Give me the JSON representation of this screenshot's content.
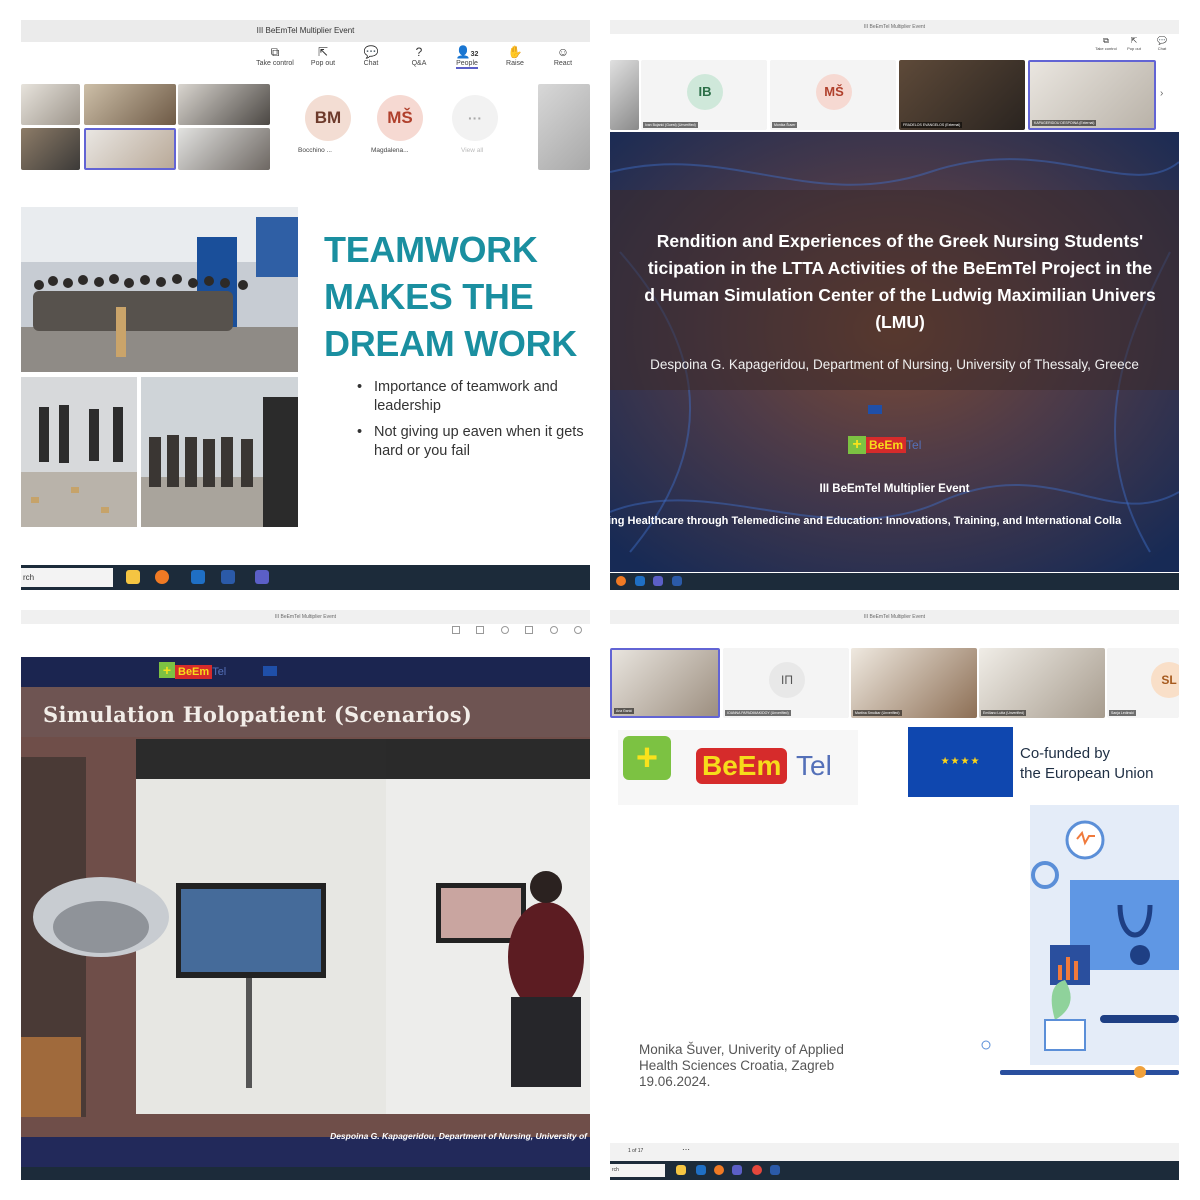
{
  "q1": {
    "window_title": "III BeEmTel Multiplier Event",
    "toolbar": [
      {
        "icon": "take-control-icon",
        "glyph": "⧉",
        "label": "Take control"
      },
      {
        "icon": "pop-out-icon",
        "glyph": "⇱",
        "label": "Pop out"
      },
      {
        "icon": "chat-icon",
        "glyph": "💬",
        "label": "Chat"
      },
      {
        "icon": "qa-icon",
        "glyph": "?",
        "label": "Q&A"
      },
      {
        "icon": "people-icon",
        "glyph": "👤",
        "label": "People",
        "badge": "32"
      },
      {
        "icon": "raise-hand-icon",
        "glyph": "✋",
        "label": "Raise"
      },
      {
        "icon": "react-icon",
        "glyph": "☺",
        "label": "React"
      }
    ],
    "participants": [
      {
        "initials": "BM",
        "name": "Bocchino ..."
      },
      {
        "initials": "MŠ",
        "name": "Magdalena..."
      },
      {
        "initials": "···",
        "name": "View all"
      }
    ],
    "slide": {
      "title_lines": [
        "TEAMWORK",
        "MAKES THE",
        "DREAM WORK"
      ],
      "bullets": [
        "Importance of teamwork and leadership",
        "Not giving up eaven when it gets hard or you fail"
      ]
    },
    "taskbar": {
      "search_text": "rch"
    }
  },
  "q2": {
    "window_title": "III BeEmTel Multiplier Event",
    "toolbar": [
      {
        "icon": "take-control-icon",
        "glyph": "⧉",
        "label": "Take control"
      },
      {
        "icon": "pop-out-icon",
        "glyph": "⇱",
        "label": "Pop out"
      },
      {
        "icon": "chat-icon",
        "glyph": "💬",
        "label": "Chat"
      }
    ],
    "participants": [
      {
        "initials": "IB",
        "name": "Ivan Bujanić (Guest) (Unverified)"
      },
      {
        "initials": "MŠ",
        "name": "Monika Šuver"
      },
      {
        "initials": "",
        "name": "FRADELOS EVANGELOS (External)"
      },
      {
        "initials": "",
        "name": "KAPAGERIDOU DESPOINA (External)"
      }
    ],
    "slide": {
      "title_lines": [
        "Rendition and Experiences of the Greek Nursing Students'",
        "ticipation in the LTTA Activities of the BeEmTel Project in the",
        "d Human Simulation Center of the Ludwig Maximilian Univers",
        "(LMU)"
      ],
      "author": "Despoina G. Kapageridou, Department of Nursing, University of Thessaly, Greece",
      "logo_text": "BeEm",
      "logo_suffix": "Tel",
      "event": "III BeEmTel Multiplier  Event",
      "subtitle": "ing Healthcare through Telemedicine and Education: Innovations, Training, and International Colla"
    }
  },
  "q3": {
    "window_title": "III BeEmTel Multiplier Event",
    "logo_text": "BeEm",
    "logo_suffix": "Tel",
    "slide": {
      "title": "Simulation Holopatient (Scenarios)",
      "footer": "Despoina G. Kapageridou, Department of Nursing, University of"
    }
  },
  "q4": {
    "window_title": "III BeEmTel Multiplier Event",
    "participants": [
      {
        "initials": "",
        "name": "Ana Đanić"
      },
      {
        "initials": "ΙΠ",
        "name": "IOANNA PAPADIMAKIDOY (Unverified)"
      },
      {
        "initials": "",
        "name": "Martina Smolkar (Unverified)"
      },
      {
        "initials": "",
        "name": "Emiliano Lutta (Unverified)"
      },
      {
        "initials": "SL",
        "name": "Sanja Ledinski"
      }
    ],
    "slide": {
      "logo_text": "BeEm",
      "logo_suffix": "Tel",
      "eu_line1": "Co-funded by",
      "eu_line2": "the European Union",
      "author_line1": "Monika Šuver, Univerity of Applied",
      "author_line2": "Health Sciences Croatia, Zagreb",
      "author_line3": "19.06.2024."
    },
    "pager": "1 of 17",
    "taskbar": {
      "search_text": "rch"
    }
  }
}
